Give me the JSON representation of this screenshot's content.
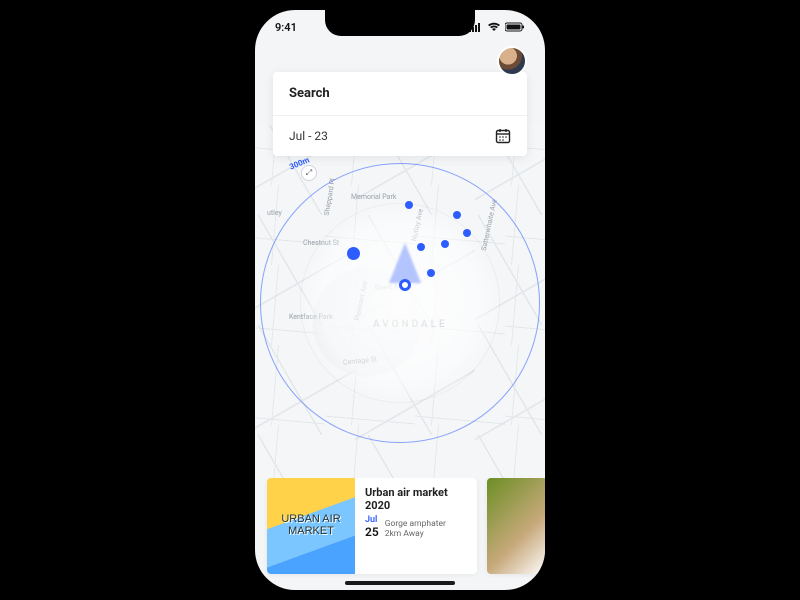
{
  "status": {
    "time": "9:41"
  },
  "search": {
    "placeholder": "Search",
    "date": "Jul - 23"
  },
  "map": {
    "range_label": "300m",
    "neighborhood": "AVONDALE",
    "streets": {
      "memorial": "Memorial Park",
      "chestnut": "Chestnut St",
      "outley": "utley",
      "grant": "Grant Ave",
      "pleasant": "Pleasant Ave",
      "kentface": "Kentface Park",
      "centage": "Centage St",
      "nutley": "Nutley Ave",
      "satterwhaite": "Satterwhaite Ave",
      "sheppard": "Sheppard Pl"
    }
  },
  "events": [
    {
      "poster_text": "URBAN AIR MARKET",
      "title": "Urban air market 2020",
      "month": "Jul",
      "day": "25",
      "venue": "Gorge amphater",
      "distance": "2km Away"
    }
  ]
}
